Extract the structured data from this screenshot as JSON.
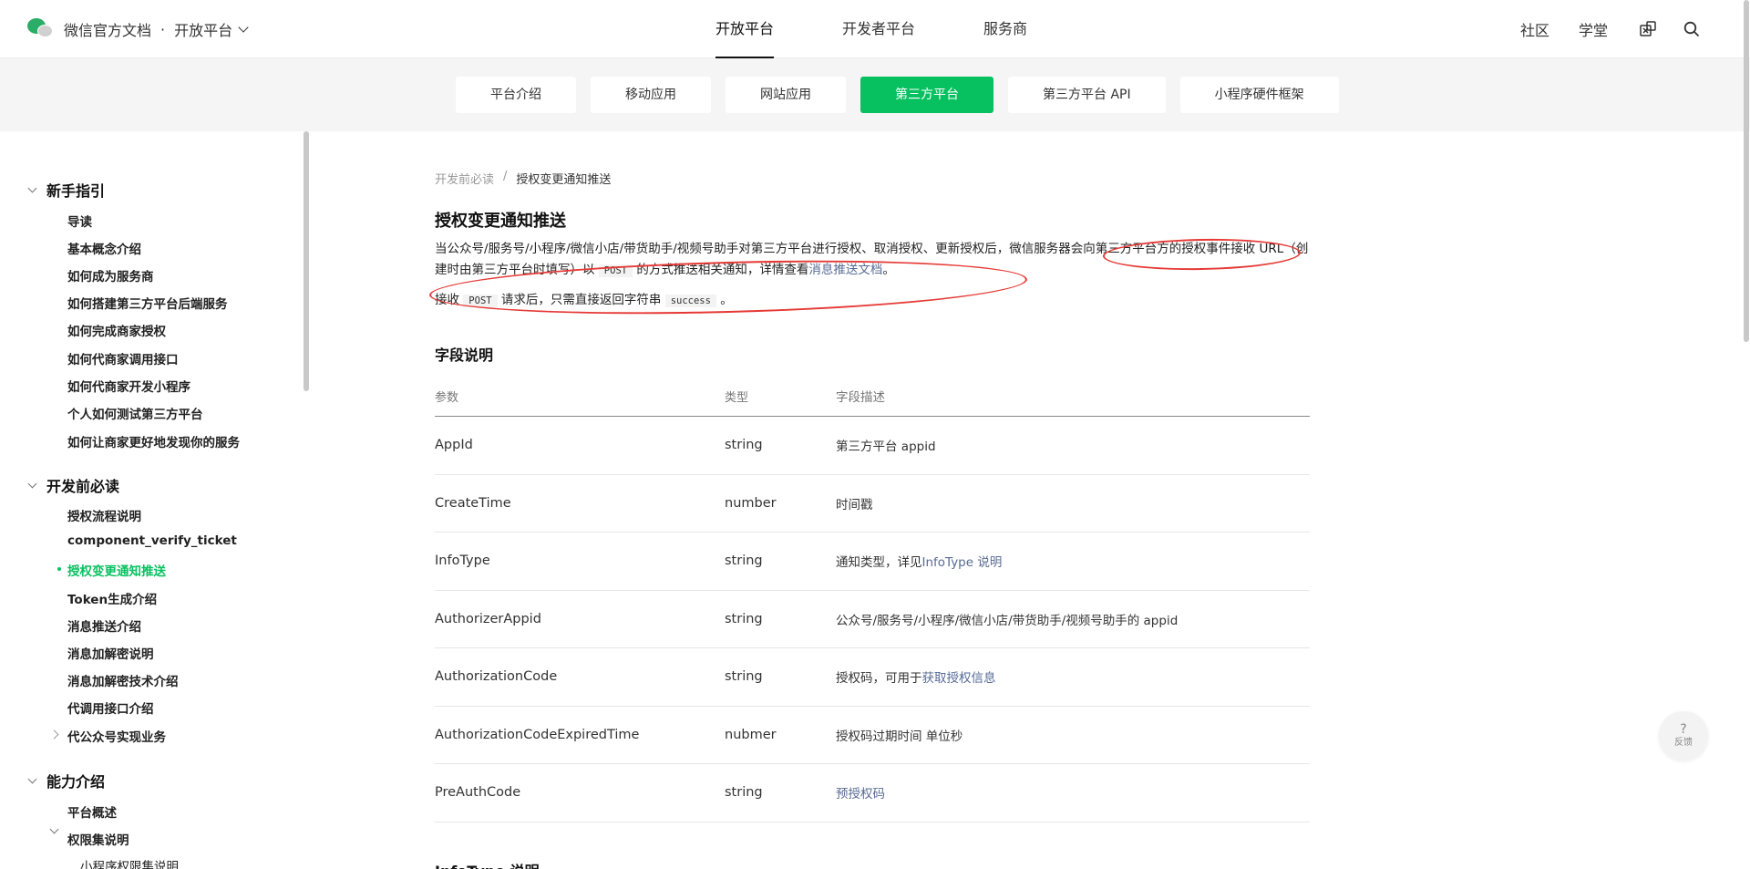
{
  "header": {
    "brand_title": "微信官方文档",
    "brand_dot": "·",
    "brand_sub": "开放平台",
    "nav": [
      "开放平台",
      "开发者平台",
      "服务商"
    ],
    "right_links": [
      "社区",
      "学堂"
    ]
  },
  "subnav": {
    "tabs": [
      "平台介绍",
      "移动应用",
      "网站应用",
      "第三方平台",
      "第三方平台 API",
      "小程序硬件框架"
    ]
  },
  "sidebar": {
    "groups": [
      "新手指引",
      "开发前必读",
      "能力介绍"
    ],
    "group1_items": [
      "导读",
      "基本概念介绍",
      "如何成为服务商",
      "如何搭建第三方平台后端服务",
      "如何完成商家授权",
      "如何代商家调用接口",
      "如何代商家开发小程序",
      "个人如何测试第三方平台",
      "如何让商家更好地发现你的服务"
    ],
    "group2_items": [
      "授权流程说明",
      "component_verify_ticket",
      "授权变更通知推送",
      "Token生成介绍",
      "消息推送介绍",
      "消息加解密说明",
      "消息加解密技术介绍",
      "代调用接口介绍",
      "代公众号实现业务"
    ],
    "group3_items": [
      "平台概述",
      "权限集说明",
      "小程序权限集说明"
    ]
  },
  "content": {
    "breadcrumb": {
      "parent": "开发前必读",
      "sep": "/",
      "current": "授权变更通知推送"
    },
    "title": "授权变更通知推送",
    "para1_a": "当公众号/服务号/小程序/微信小店/带货助手/视频号助手对第三方平台进行授权、取消授权、更新授权后，微信服务器会向第三方平台方的授权事件接收 URL（创建时由第三方平台时填写）以",
    "para1_code": "POST",
    "para1_b": "的方式推送相关通知，详情查看",
    "para1_link": "消息推送文档",
    "para1_end": "。",
    "para2_a": "接收",
    "para2_code1": "POST",
    "para2_b": "请求后，只需直接返回字符串",
    "para2_code2": "success",
    "para2_end": "。",
    "section_title": "字段说明",
    "table_headers": [
      "参数",
      "类型",
      "字段描述"
    ],
    "rows": [
      {
        "param": "AppId",
        "type": "string",
        "desc": "第三方平台 appid",
        "link": ""
      },
      {
        "param": "CreateTime",
        "type": "number",
        "desc": "时间戳",
        "link": ""
      },
      {
        "param": "InfoType",
        "type": "string",
        "desc": "通知类型，详见",
        "link": "InfoType 说明"
      },
      {
        "param": "AuthorizerAppid",
        "type": "string",
        "desc": "公众号/服务号/小程序/微信小店/带货助手/视频号助手的 appid",
        "link": ""
      },
      {
        "param": "AuthorizationCode",
        "type": "string",
        "desc": "授权码，可用于",
        "link": "获取授权信息"
      },
      {
        "param": "AuthorizationCodeExpiredTime",
        "type": "nubmer",
        "desc": "授权码过期时间 单位秒",
        "link": ""
      },
      {
        "param": "PreAuthCode",
        "type": "string",
        "desc": "",
        "link": "预授权码"
      }
    ],
    "next_section": "InfoType 说明"
  },
  "feedback": {
    "icon": "?",
    "label": "反馈"
  },
  "colors": {
    "accent": "#07c160",
    "link": "#576b95",
    "annotation": "#e53935"
  }
}
